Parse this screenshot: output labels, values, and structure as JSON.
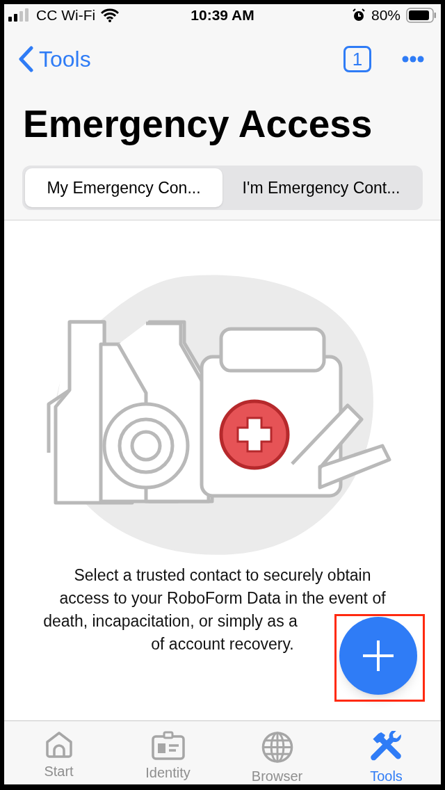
{
  "status_bar": {
    "carrier": "CC Wi-Fi",
    "time": "10:39 AM",
    "battery": "80%"
  },
  "nav": {
    "back": "Tools",
    "badge": "1"
  },
  "title": "Emergency Access",
  "segments": [
    {
      "label": "My Emergency Con...",
      "selected": true
    },
    {
      "label": "I'm Emergency Cont...",
      "selected": false
    }
  ],
  "description_lines": [
    "Select a trusted contact to securely obtain",
    "access to your RoboForm Data in the event of",
    "death, incapacitation, or simply as a",
    "of account recovery."
  ],
  "tab_bar": [
    {
      "label": "Start",
      "kind": "home",
      "selected": false
    },
    {
      "label": "Identity",
      "kind": "identity",
      "selected": false
    },
    {
      "label": "Browser",
      "kind": "globe",
      "selected": false
    },
    {
      "label": "Tools",
      "kind": "tools",
      "selected": true
    }
  ]
}
